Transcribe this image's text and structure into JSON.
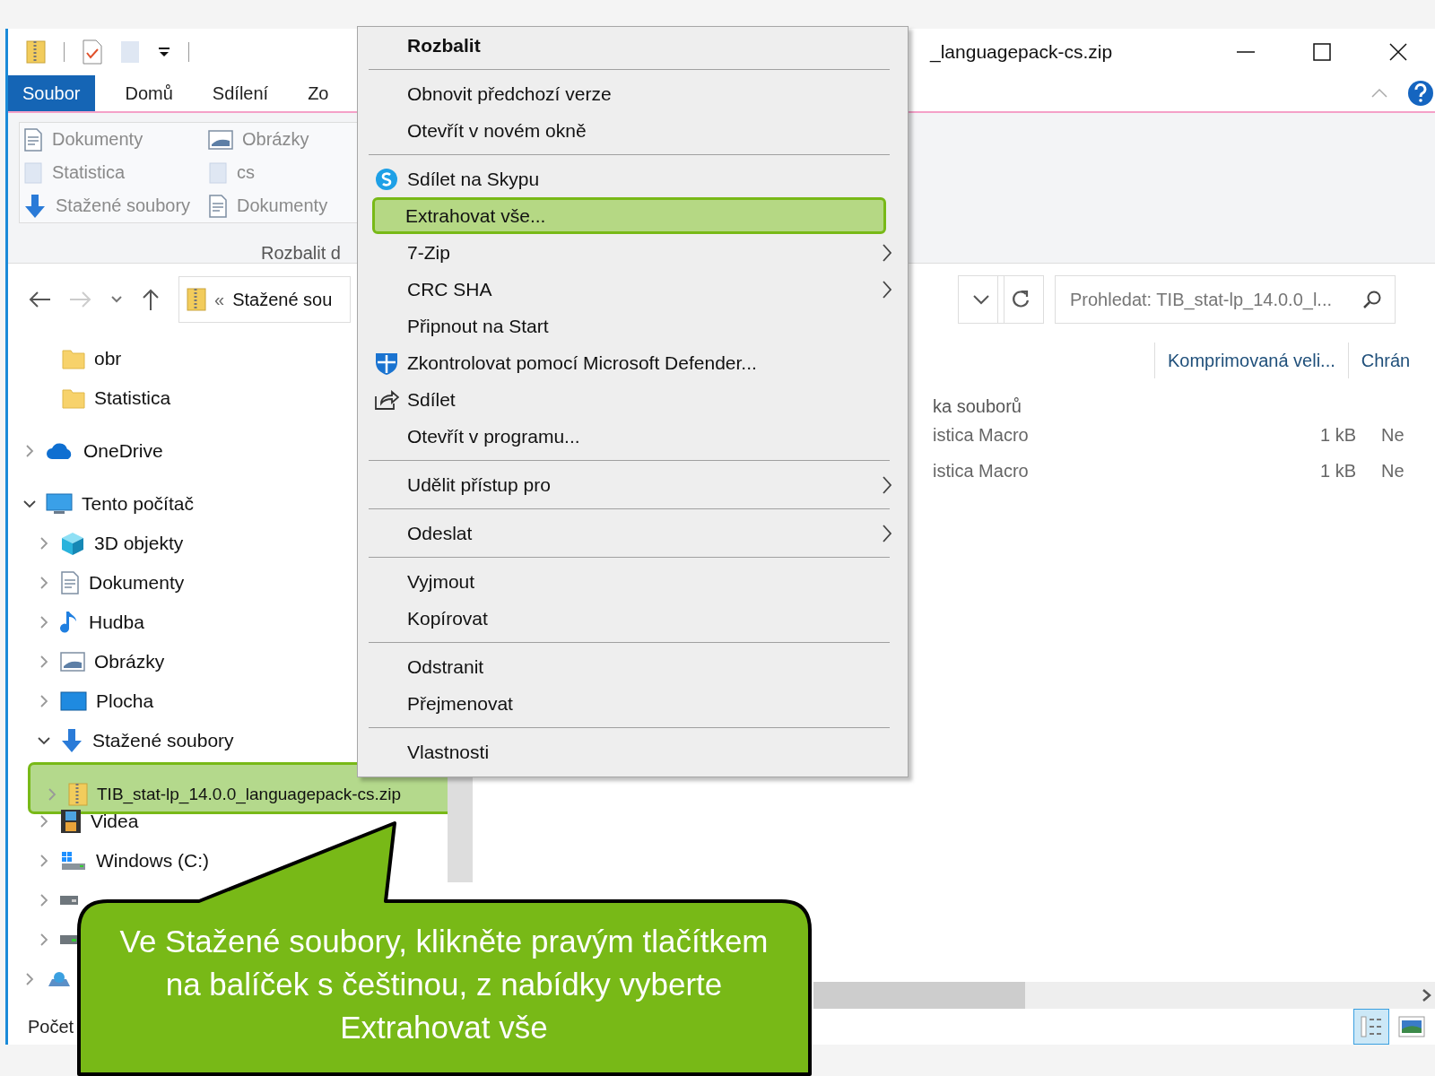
{
  "window": {
    "title": "_languagepack-cs.zip"
  },
  "tabs": [
    {
      "label": "Soubor",
      "selected": true
    },
    {
      "label": "Domů",
      "selected": false
    },
    {
      "label": "Sdílení",
      "selected": false
    },
    {
      "label": "Zo",
      "selected": false
    }
  ],
  "ribbon": {
    "items": [
      {
        "label": "Dokumenty",
        "kind": "document"
      },
      {
        "label": "Statistica",
        "kind": "folder"
      },
      {
        "label": "Stažené soubory",
        "kind": "download"
      },
      {
        "label": "Obrázky",
        "kind": "pictures"
      },
      {
        "label": "cs",
        "kind": "folder"
      },
      {
        "label": "Dokumenty",
        "kind": "document"
      }
    ],
    "group_label": "Rozbalit d"
  },
  "address": {
    "prefix": "«",
    "path": "Stažené sou"
  },
  "search": {
    "placeholder": "Prohledat: TIB_stat-lp_14.0.0_l..."
  },
  "quick_access": [
    {
      "label": "obr"
    },
    {
      "label": "Statistica"
    }
  ],
  "tree": [
    {
      "label": "OneDrive",
      "kind": "cloud",
      "expanded": false
    },
    {
      "label": "Tento počítač",
      "kind": "pc",
      "expanded": true,
      "children": [
        {
          "label": "3D objekty",
          "kind": "cube",
          "expanded": false
        },
        {
          "label": "Dokumenty",
          "kind": "document",
          "expanded": false
        },
        {
          "label": "Hudba",
          "kind": "music",
          "expanded": false
        },
        {
          "label": "Obrázky",
          "kind": "pictures",
          "expanded": false
        },
        {
          "label": "Plocha",
          "kind": "desktop",
          "expanded": false
        },
        {
          "label": "Stažené soubory",
          "kind": "download",
          "expanded": true,
          "children": [
            {
              "label": "TIB_stat-lp_14.0.0_languagepack-cs.zip",
              "kind": "zip",
              "expanded": false,
              "selected": true
            }
          ]
        },
        {
          "label": "Videa",
          "kind": "video",
          "expanded": false
        },
        {
          "label": "Windows (C:)",
          "kind": "windows-drive",
          "expanded": false
        },
        {
          "kind": "drive",
          "expanded": false
        },
        {
          "kind": "drive2",
          "expanded": false
        }
      ]
    },
    {
      "kind": "network",
      "expanded": false
    }
  ],
  "columns": [
    {
      "label": "Komprimovaná veli..."
    },
    {
      "label": "Chrán"
    }
  ],
  "content": {
    "group": "ka souborů",
    "rows": [
      {
        "name": "istica Macro",
        "size": "1 kB",
        "protected": "Ne"
      },
      {
        "name": "istica Macro",
        "size": "1 kB",
        "protected": "Ne"
      }
    ]
  },
  "status_bar": "Počet",
  "context_menu": [
    {
      "label": "Rozbalit",
      "kind": "bold"
    },
    {
      "kind": "separator"
    },
    {
      "label": "Obnovit předchozí verze",
      "kind": "plain"
    },
    {
      "label": "Otevřít v novém okně",
      "kind": "plain"
    },
    {
      "kind": "separator"
    },
    {
      "label": "Sdílet na Skypu",
      "kind": "skype"
    },
    {
      "label": "Extrahovat vše...",
      "kind": "plain",
      "selected": true
    },
    {
      "label": "7-Zip",
      "kind": "submenu"
    },
    {
      "label": "CRC SHA",
      "kind": "submenu"
    },
    {
      "label": "Připnout na Start",
      "kind": "plain"
    },
    {
      "label": "Zkontrolovat pomocí Microsoft Defender...",
      "kind": "defender"
    },
    {
      "label": "Sdílet",
      "kind": "share"
    },
    {
      "label": "Otevřít v programu...",
      "kind": "plain"
    },
    {
      "kind": "separator"
    },
    {
      "label": "Udělit přístup pro",
      "kind": "submenu"
    },
    {
      "kind": "separator"
    },
    {
      "label": "Odeslat",
      "kind": "submenu"
    },
    {
      "kind": "separator"
    },
    {
      "label": "Vyjmout",
      "kind": "plain"
    },
    {
      "label": "Kopírovat",
      "kind": "plain"
    },
    {
      "kind": "separator"
    },
    {
      "label": "Odstranit",
      "kind": "plain"
    },
    {
      "label": "Přejmenovat",
      "kind": "plain"
    },
    {
      "kind": "separator"
    },
    {
      "label": "Vlastnosti",
      "kind": "plain"
    }
  ],
  "callout": {
    "text": "Ve Stažené soubory, klikněte pravým tlačítkem na balíček s češtinou, z nabídky vyberte Extrahovat vše"
  }
}
